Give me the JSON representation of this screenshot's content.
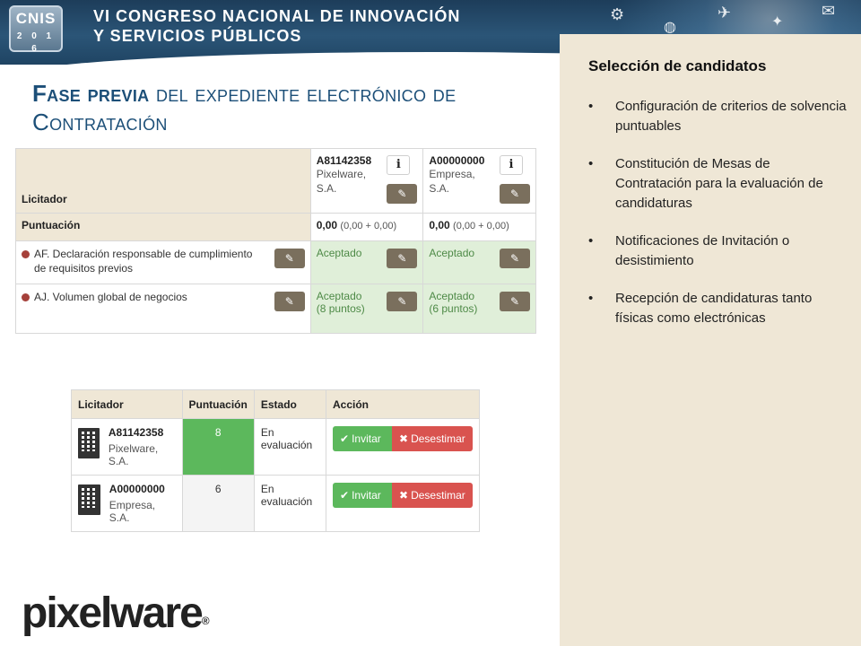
{
  "banner": {
    "logo_top": "CNIS",
    "logo_year": "2 0 1 6",
    "title_line1": "VI CONGRESO NACIONAL DE INNOVACIÓN",
    "title_line2": "Y SERVICIOS PÚBLICOS"
  },
  "page": {
    "title_bold": "Fase previa",
    "title_rest": " del expediente electrónico de Contratación"
  },
  "evaluation_table": {
    "licitador_label": "Licitador",
    "puntuacion_label": "Puntuación",
    "info_glyph": "i",
    "suppliers": [
      {
        "id": "A81142358",
        "name_line1": "Pixelware,",
        "name_line2": "S.A.",
        "score": "0,00",
        "score_detail": "(0,00 + 0,00)"
      },
      {
        "id": "A00000000",
        "name_line1": "Empresa,",
        "name_line2": "S.A.",
        "score": "0,00",
        "score_detail": "(0,00 + 0,00)"
      }
    ],
    "criteria": [
      {
        "label": "AF. Declaración responsable de cumplimiento de requisitos previos",
        "values": [
          {
            "status": "Aceptado",
            "detail": ""
          },
          {
            "status": "Aceptado",
            "detail": ""
          }
        ]
      },
      {
        "label": "AJ. Volumen global de negocios",
        "values": [
          {
            "status": "Aceptado",
            "detail": "(8 puntos)"
          },
          {
            "status": "Aceptado",
            "detail": "(6 puntos)"
          }
        ]
      }
    ]
  },
  "ranking_table": {
    "headers": [
      "Licitador",
      "Puntuación",
      "Estado",
      "Acción"
    ],
    "rows": [
      {
        "id": "A81142358",
        "name": "Pixelware, S.A.",
        "score": "8",
        "estado": "En evaluación"
      },
      {
        "id": "A00000000",
        "name": "Empresa, S.A.",
        "score": "6",
        "estado": "En evaluación"
      }
    ],
    "invite_label": "Invitar",
    "dismiss_label": "Desestimar"
  },
  "panel": {
    "title": "Selección de candidatos",
    "items": [
      "Configuración de criterios de solvencia puntuables",
      "Constitución de Mesas de Contratación para la evaluación de candidaturas",
      "Notificaciones de Invitación o desistimiento",
      "Recepción de candidaturas tanto físicas como electrónicas"
    ]
  },
  "footer": {
    "brand": "pixelware",
    "registered": "®"
  },
  "colors": {
    "banner": "#2b5577",
    "panel": "#efe7d6",
    "title": "#1c4f78",
    "accepted_bg": "#e0efd9",
    "invite": "#5cb85c",
    "dismiss": "#d9534f",
    "edit_button": "#7a6f5d"
  },
  "icons": [
    "info-icon",
    "edit-icon",
    "status-dot-icon",
    "building-icon",
    "check-icon",
    "times-icon"
  ]
}
